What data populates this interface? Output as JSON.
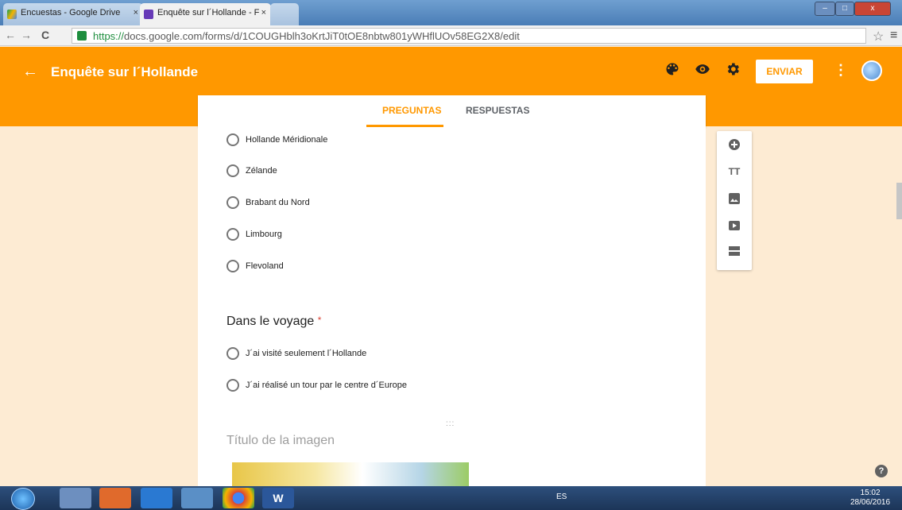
{
  "browser": {
    "tabs": [
      {
        "label": "Encuestas - Google Drive",
        "close": "×"
      },
      {
        "label": "Enquête sur l´Hollande - F",
        "close": "×"
      }
    ],
    "url_scheme": "https://",
    "url_rest": "docs.google.com/forms/d/1COUGHblh3oKrtJiT0tOE8nbtw801yWHflUOv58EG2X8/edit",
    "back": "←",
    "forward": "→",
    "reload": "C",
    "star": "☆",
    "menu": "≡",
    "window_controls": {
      "minimize": "–",
      "maximize": "□",
      "close": "x"
    }
  },
  "header": {
    "back_arrow": "←",
    "title": "Enquête sur l´Hollande",
    "send_label": "ENVIAR",
    "more": "⋮",
    "icons": [
      "palette-icon",
      "eye-icon",
      "settings-icon"
    ],
    "brand_color": "#ff9800"
  },
  "form_tabs": {
    "questions": "PREGUNTAS",
    "responses": "RESPUESTAS"
  },
  "question1": {
    "options": [
      "Hollande Méridionale",
      "Zélande",
      "Brabant du Nord",
      "Limbourg",
      "Flevoland"
    ]
  },
  "question2": {
    "title": "Dans le voyage",
    "required_mark": "*",
    "options": [
      "J´ai visité seulement  l´Hollande",
      "J´ai réalisé un tour par le centre d´Europe"
    ]
  },
  "image_section": {
    "drag_handle": ":::",
    "title_placeholder": "Título de la imagen"
  },
  "sidebar": {
    "icons": [
      "add-question-icon",
      "title-text-icon",
      "image-icon",
      "video-icon",
      "section-icon"
    ],
    "title_text_glyph": "TT"
  },
  "help": "?",
  "taskbar": {
    "word_label": "W",
    "language": "ES",
    "time": "15:02",
    "date": "28/06/2016"
  }
}
